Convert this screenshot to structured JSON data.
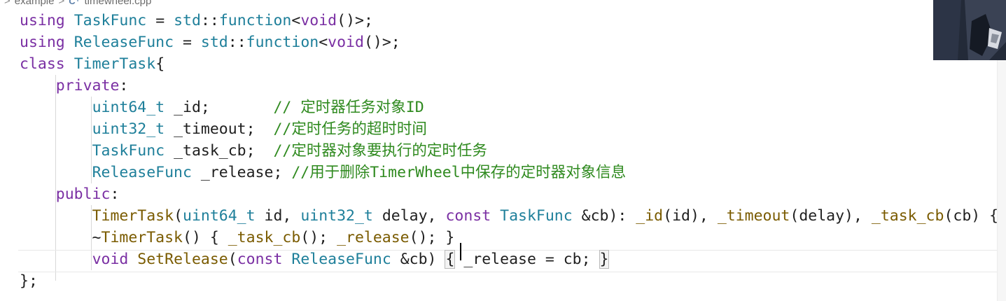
{
  "breadcrumb": {
    "folder": "example",
    "file_icon": "C⁺",
    "file": "timewheel.cpp",
    "separator": ">"
  },
  "editor": {
    "lines": [
      {
        "tokens": [
          [
            "kw",
            "using"
          ],
          [
            "pl",
            " "
          ],
          [
            "ty",
            "TaskFunc"
          ],
          [
            "pl",
            " = "
          ],
          [
            "ty",
            "std"
          ],
          [
            "pl",
            "::"
          ],
          [
            "ty",
            "function"
          ],
          [
            "pl",
            "<"
          ],
          [
            "kw",
            "void"
          ],
          [
            "pl",
            "()>;"
          ]
        ]
      },
      {
        "tokens": [
          [
            "kw",
            "using"
          ],
          [
            "pl",
            " "
          ],
          [
            "ty",
            "ReleaseFunc"
          ],
          [
            "pl",
            " = "
          ],
          [
            "ty",
            "std"
          ],
          [
            "pl",
            "::"
          ],
          [
            "ty",
            "function"
          ],
          [
            "pl",
            "<"
          ],
          [
            "kw",
            "void"
          ],
          [
            "pl",
            "()>;"
          ]
        ]
      },
      {
        "tokens": [
          [
            "kw",
            "class"
          ],
          [
            "pl",
            " "
          ],
          [
            "ty",
            "TimerTask"
          ],
          [
            "pl",
            "{"
          ]
        ]
      },
      {
        "tokens": [
          [
            "pl",
            "    "
          ],
          [
            "kw",
            "private"
          ],
          [
            "pl",
            ":"
          ]
        ]
      },
      {
        "tokens": [
          [
            "pl",
            "        "
          ],
          [
            "ty",
            "uint64_t"
          ],
          [
            "pl",
            " _id;       "
          ],
          [
            "cm",
            "// 定时器任务对象ID"
          ]
        ]
      },
      {
        "tokens": [
          [
            "pl",
            "        "
          ],
          [
            "ty",
            "uint32_t"
          ],
          [
            "pl",
            " _timeout;  "
          ],
          [
            "cm",
            "//定时任务的超时时间"
          ]
        ]
      },
      {
        "tokens": [
          [
            "pl",
            "        "
          ],
          [
            "ty",
            "TaskFunc"
          ],
          [
            "pl",
            " _task_cb;  "
          ],
          [
            "cm",
            "//定时器对象要执行的定时任务"
          ]
        ]
      },
      {
        "tokens": [
          [
            "pl",
            "        "
          ],
          [
            "ty",
            "ReleaseFunc"
          ],
          [
            "pl",
            " _release; "
          ],
          [
            "cm",
            "//用于删除TimerWheel中保存的定时器对象信息"
          ]
        ]
      },
      {
        "tokens": [
          [
            "pl",
            "    "
          ],
          [
            "kw",
            "public"
          ],
          [
            "pl",
            ":"
          ]
        ]
      },
      {
        "tokens": [
          [
            "pl",
            "        "
          ],
          [
            "fn",
            "TimerTask"
          ],
          [
            "pl",
            "("
          ],
          [
            "ty",
            "uint64_t"
          ],
          [
            "pl",
            " id, "
          ],
          [
            "ty",
            "uint32_t"
          ],
          [
            "pl",
            " delay, "
          ],
          [
            "kw",
            "const"
          ],
          [
            "pl",
            " "
          ],
          [
            "ty",
            "TaskFunc"
          ],
          [
            "pl",
            " &cb): "
          ],
          [
            "fn",
            "_id"
          ],
          [
            "pl",
            "(id), "
          ],
          [
            "fn",
            "_timeout"
          ],
          [
            "pl",
            "(delay), "
          ],
          [
            "fn",
            "_task_cb"
          ],
          [
            "pl",
            "(cb) {}"
          ]
        ]
      },
      {
        "tokens": [
          [
            "pl",
            "        ~"
          ],
          [
            "fn",
            "TimerTask"
          ],
          [
            "pl",
            "() { "
          ],
          [
            "fn",
            "_task_cb"
          ],
          [
            "pl",
            "(); "
          ],
          [
            "fn",
            "_release"
          ],
          [
            "pl",
            "(); }"
          ]
        ]
      },
      {
        "tokens": [
          [
            "pl",
            "        "
          ],
          [
            "kw",
            "void"
          ],
          [
            "pl",
            " "
          ],
          [
            "fn",
            "SetRelease"
          ],
          [
            "pl",
            "("
          ],
          [
            "kw",
            "const"
          ],
          [
            "pl",
            " "
          ],
          [
            "ty",
            "ReleaseFunc"
          ],
          [
            "pl",
            " &cb) "
          ],
          [
            "bb",
            "{"
          ],
          [
            "pl",
            " _release = cb; "
          ],
          [
            "bb",
            "}"
          ]
        ]
      },
      {
        "tokens": [
          [
            "pl",
            "};"
          ]
        ]
      }
    ]
  },
  "colors": {
    "keyword": "#7a2fa3",
    "type": "#1e7f9a",
    "function": "#7a5b00",
    "comment": "#2f8a1f",
    "plain": "#1f1f1f"
  }
}
